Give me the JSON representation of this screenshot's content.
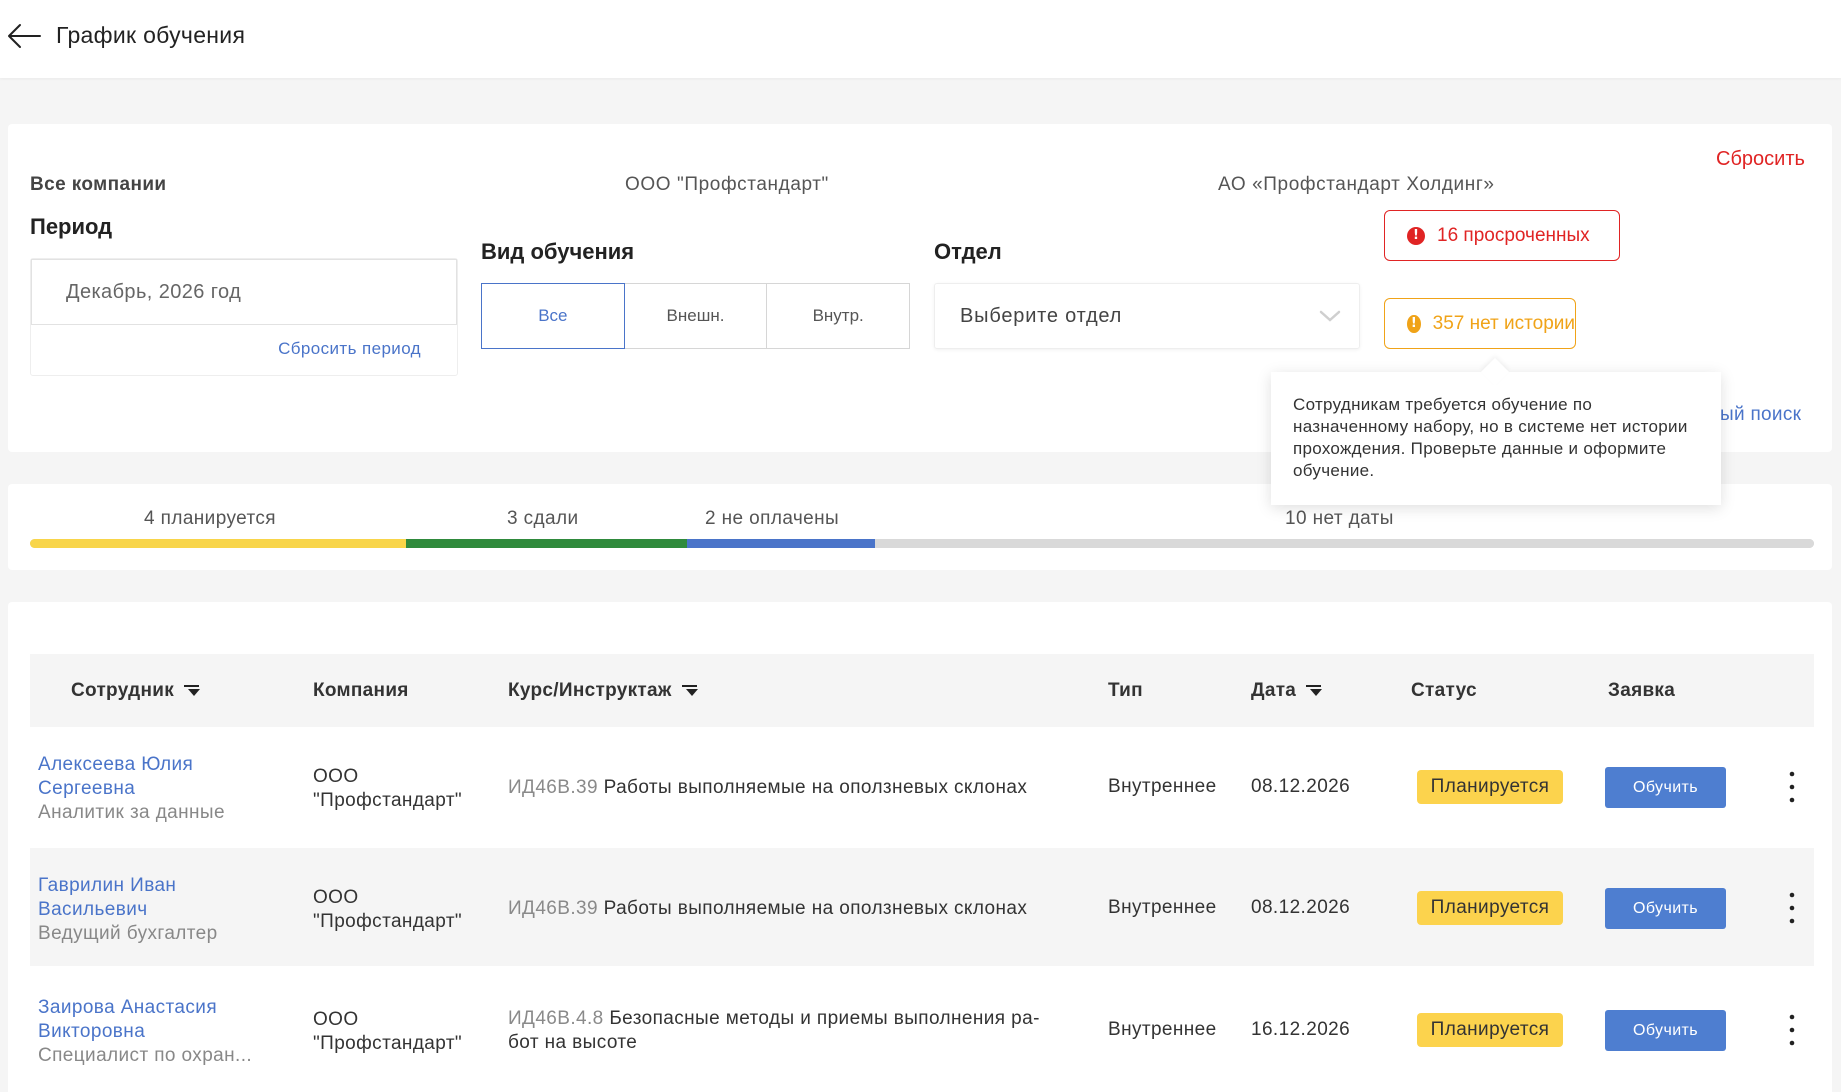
{
  "header": {
    "title": "График обучения"
  },
  "filters": {
    "companies": [
      "Все компании",
      "ООО \"Профстандарт\"",
      "АО «Профстандарт Холдинг»"
    ],
    "reset_label": "Сбросить",
    "period": {
      "label": "Период",
      "value": "Декабрь, 2026 год",
      "reset_label": "Сбросить период"
    },
    "training_type": {
      "label": "Вид обучения",
      "options": [
        "Все",
        "Внешн.",
        "Внутр."
      ],
      "selected": "Все"
    },
    "department": {
      "label": "Отдел",
      "placeholder": "Выберите отдел"
    },
    "alerts": {
      "overdue": "16 просроченных",
      "no_history": "357 нет истории"
    },
    "advanced_search_visible": "ый поиск",
    "tooltip": "Сотрудникам требуется обучение по назначенному набору, но в системе нет истории прохождения. Проверьте данные и оформите обучение."
  },
  "progress": {
    "planned": {
      "label": "4 планируется",
      "count": 4,
      "color": "#f8d54a"
    },
    "passed": {
      "label": "3 сдали",
      "count": 3,
      "color": "#2f8a3c"
    },
    "unpaid": {
      "label": "2 не оплачены",
      "count": 2,
      "color": "#4a74c9"
    },
    "no_date": {
      "label": "10 нет даты",
      "count": 10,
      "color": "#d9d9d9"
    }
  },
  "table": {
    "columns": {
      "employee": "Сотрудник",
      "company": "Компания",
      "course": "Курс/Инструктаж",
      "type": "Тип",
      "date": "Дата",
      "status": "Статус",
      "request": "Заявка"
    },
    "rows": [
      {
        "name_line1": "Алексеева Юлия",
        "name_line2": "Сергеевна",
        "role": "Аналитик за данные",
        "company_line1": "ООО",
        "company_line2": "\"Профстандарт\"",
        "course_code": "ИД46В.39",
        "course_line1": "Работы выполняемые на оползневых склонах",
        "course_line2": "",
        "type": "Внутреннее",
        "date": "08.12.2026",
        "status": "Планируется",
        "action": "Обучить"
      },
      {
        "name_line1": "Гаврилин Иван",
        "name_line2": "Васильевич",
        "role": "Ведущий бухгалтер",
        "company_line1": "ООО",
        "company_line2": "\"Профстандарт\"",
        "course_code": "ИД46В.39",
        "course_line1": "Работы выполняемые на оползневых склонах",
        "course_line2": "",
        "type": "Внутреннее",
        "date": "08.12.2026",
        "status": "Планируется",
        "action": "Обучить"
      },
      {
        "name_line1": "Заирова Анастасия",
        "name_line2": "Викторовна",
        "role": "Специалист по охран...",
        "company_line1": "ООО",
        "company_line2": "\"Профстандарт\"",
        "course_code": "ИД46В.4.8",
        "course_line1": "Безопасные методы и приемы выполнения ра-",
        "course_line2": "бот на высоте",
        "type": "Внутреннее",
        "date": "16.12.2026",
        "status": "Планируется",
        "action": "Обучить"
      }
    ]
  }
}
